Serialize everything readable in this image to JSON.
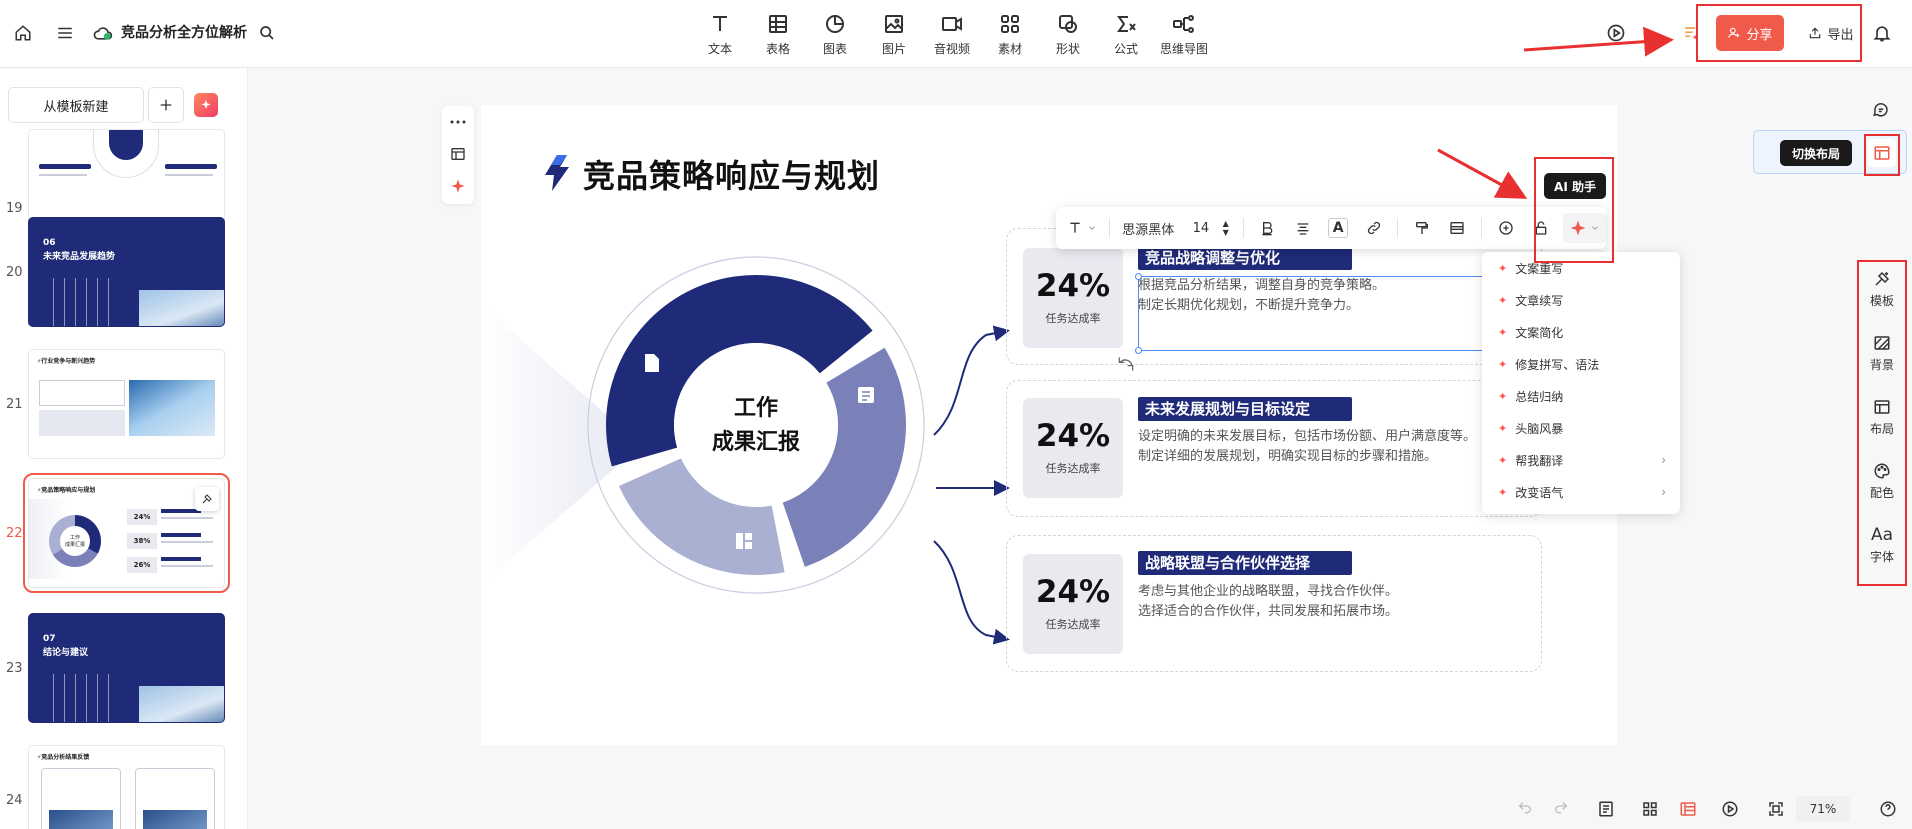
{
  "header": {
    "doc_title": "竞品分析全方位解析",
    "tools": [
      {
        "icon": "text-icon",
        "label": "文本"
      },
      {
        "icon": "table-icon",
        "label": "表格"
      },
      {
        "icon": "chart-icon",
        "label": "图表"
      },
      {
        "icon": "image-icon",
        "label": "图片"
      },
      {
        "icon": "video-icon",
        "label": "音视频"
      },
      {
        "icon": "material-icon",
        "label": "素材"
      },
      {
        "icon": "shape-icon",
        "label": "形状"
      },
      {
        "icon": "formula-icon",
        "label": "公式"
      },
      {
        "icon": "mindmap-icon",
        "label": "思维导图"
      }
    ],
    "share_label": "分享",
    "export_label": "导出"
  },
  "sidebar": {
    "new_from_template": "从模板新建",
    "slides": [
      {
        "num": "19",
        "heading": ""
      },
      {
        "num": "20",
        "heading": "06\n未来竞品发展趋势"
      },
      {
        "num": "21",
        "heading": "行业竞争与新兴趋势"
      },
      {
        "num": "22",
        "heading": "竞品策略响应与规划",
        "selected": true
      },
      {
        "num": "23",
        "heading": "07\n结论与建议"
      },
      {
        "num": "24",
        "heading": "竞品分析结果反馈"
      }
    ]
  },
  "slide": {
    "title": "竞品策略响应与规划",
    "center_line1": "工作",
    "center_line2": "成果汇报",
    "cards": [
      {
        "percent": "24%",
        "caption": "任务达成率",
        "title": "竞品战略调整与优化",
        "line1": "根据竞品分析结果，调整自身的竞争策略。",
        "line2": "制定长期优化规划，不断提升竞争力。"
      },
      {
        "percent": "24%",
        "caption": "任务达成率",
        "title": "未来发展规划与目标设定",
        "line1": "设定明确的未来发展目标，包括市场份额、用户满意度等。",
        "line2": "制定详细的发展规划，明确实现目标的步骤和措施。"
      },
      {
        "percent": "24%",
        "caption": "任务达成率",
        "title": "战略联盟与合作伙伴选择",
        "line1": "考虑与其他企业的战略联盟，寻找合作伙伴。",
        "line2": "选择适合的合作伙伴，共同发展和拓展市场。"
      }
    ]
  },
  "format_bar": {
    "font_name": "思源黑体",
    "font_size": "14",
    "ai_tooltip": "AI 助手"
  },
  "ai_menu": {
    "items": [
      {
        "label": "文案重写",
        "submenu": false
      },
      {
        "label": "文章续写",
        "submenu": false
      },
      {
        "label": "文案简化",
        "submenu": false
      },
      {
        "label": "修复拼写、语法",
        "submenu": false
      },
      {
        "label": "总结归纳",
        "submenu": false
      },
      {
        "label": "头脑风暴",
        "submenu": false
      },
      {
        "label": "帮我翻译",
        "submenu": true
      },
      {
        "label": "改变语气",
        "submenu": true
      }
    ]
  },
  "right_panel": {
    "switch_layout_tooltip": "切换布局",
    "tools": [
      {
        "icon": "template-icon",
        "label": "模板"
      },
      {
        "icon": "background-icon",
        "label": "背景"
      },
      {
        "icon": "layout-icon",
        "label": "布局"
      },
      {
        "icon": "palette-icon",
        "label": "配色"
      },
      {
        "icon": "font-icon",
        "glyph": "Aa",
        "label": "字体"
      }
    ]
  },
  "bottom_bar": {
    "zoom": "71%"
  },
  "colors": {
    "accent": "#f05a4a",
    "navy": "#1f2a78",
    "annotation_red": "#e83030"
  }
}
